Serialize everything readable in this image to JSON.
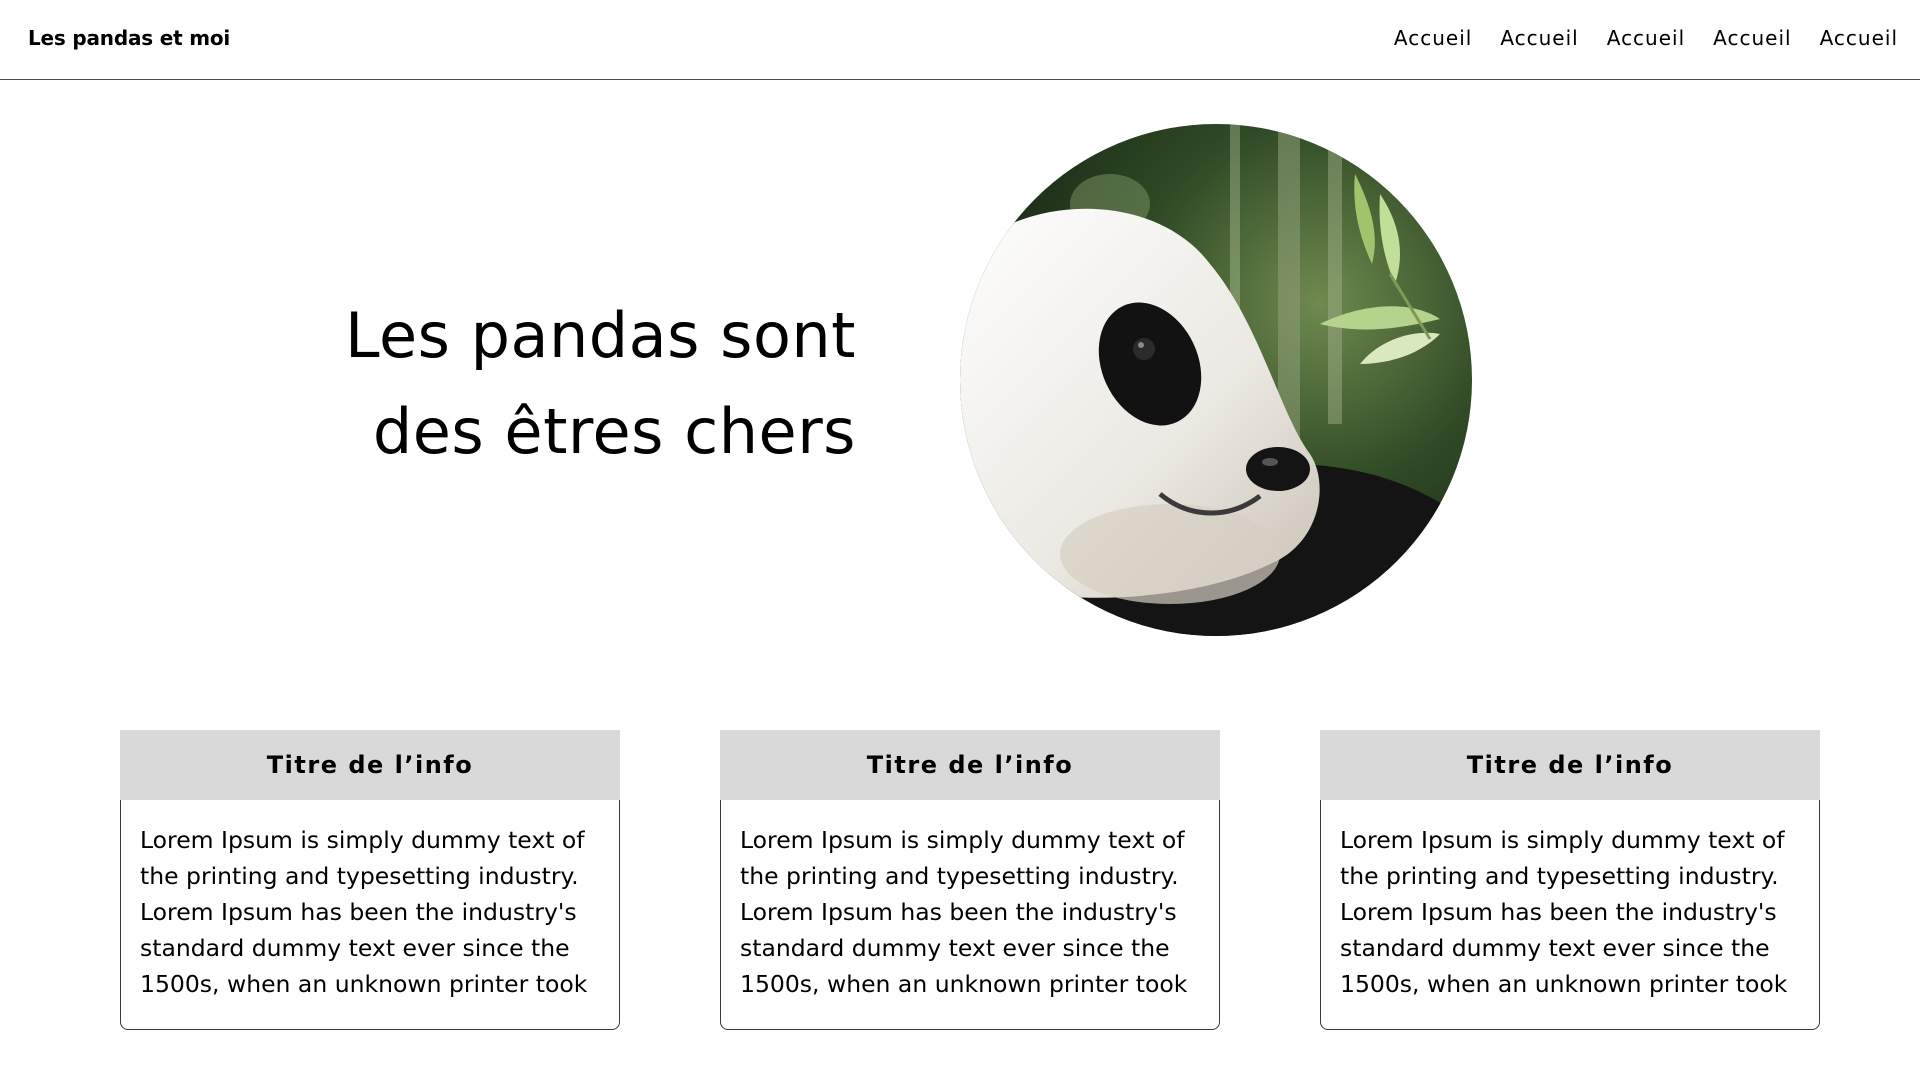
{
  "header": {
    "brand": "Les pandas et moi",
    "nav": [
      "Accueil",
      "Accueil",
      "Accueil",
      "Accueil",
      "Accueil"
    ]
  },
  "hero": {
    "title_lines": [
      "Les pandas sont",
      "des êtres chers"
    ],
    "image_icon": "panda-photo"
  },
  "cards": [
    {
      "title": "Titre de l’info",
      "text": "Lorem Ipsum is simply dummy text of the printing and typesetting industry. Lorem Ipsum has been the industry's standard dummy text ever since the 1500s, when an unknown printer took"
    },
    {
      "title": "Titre de l’info",
      "text": "Lorem Ipsum is simply dummy text of the printing and typesetting industry. Lorem Ipsum has been the industry's standard dummy text ever since the 1500s, when an unknown printer took"
    },
    {
      "title": "Titre de l’info",
      "text": "Lorem Ipsum is simply dummy text of the printing and typesetting industry. Lorem Ipsum has been the industry's standard dummy text ever since the 1500s, when an unknown printer took"
    }
  ],
  "colors": {
    "card_header_bg": "#d9d9d9",
    "border": "#3a3a3a",
    "text": "#000000"
  }
}
